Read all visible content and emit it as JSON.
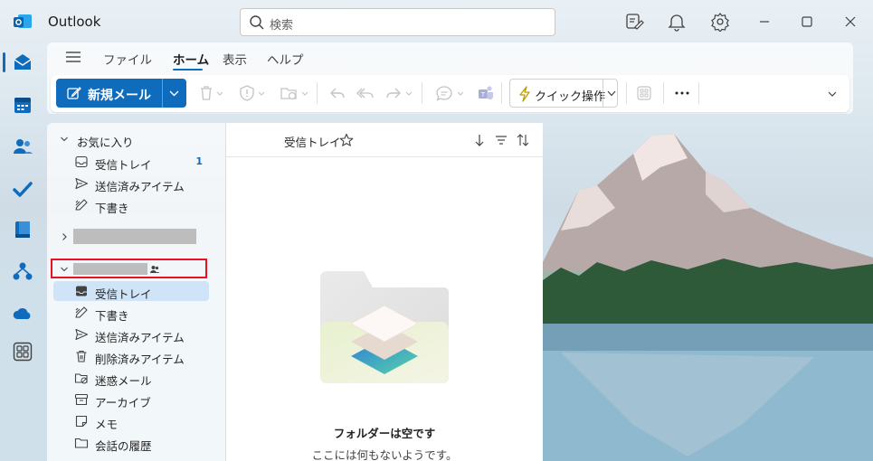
{
  "app": {
    "title": "Outlook",
    "accent_color": "#0f6cbd"
  },
  "search": {
    "placeholder": "検索",
    "icon": "search-icon"
  },
  "titlebar_icons": [
    "whats-new-icon",
    "bell-icon",
    "gear-icon",
    "minimize-icon",
    "maximize-icon",
    "close-icon"
  ],
  "rail": {
    "items": [
      "mail-icon",
      "calendar-icon",
      "people-icon",
      "todo-icon",
      "bookings-icon",
      "org-icon",
      "onedrive-icon",
      "apps-icon"
    ],
    "selected": "mail-icon"
  },
  "menu": {
    "tabs": [
      {
        "label": "ファイル"
      },
      {
        "label": "ホーム",
        "active": true
      },
      {
        "label": "表示"
      },
      {
        "label": "ヘルプ"
      }
    ]
  },
  "toolbar": {
    "new_mail_label": "新規メール",
    "quick_steps_label": "クイック操作",
    "icons": [
      "delete-icon",
      "report-icon",
      "move-icon",
      "reply-icon",
      "reply-all-icon",
      "forward-icon",
      "chat-icon",
      "teams-icon",
      "addins-icon",
      "more-icon",
      "expand-icon"
    ]
  },
  "folders": {
    "favorites_label": "お気に入り",
    "favorites": [
      {
        "label": "受信トレイ",
        "count": "1",
        "icon": "inbox-icon"
      },
      {
        "label": "送信済みアイテム",
        "icon": "send-icon"
      },
      {
        "label": "下書き",
        "icon": "draft-icon"
      }
    ],
    "account_folders": [
      {
        "label": "受信トレイ",
        "icon": "inbox-icon",
        "selected": true
      },
      {
        "label": "下書き",
        "icon": "draft-icon"
      },
      {
        "label": "送信済みアイテム",
        "icon": "send-icon"
      },
      {
        "label": "削除済みアイテム",
        "icon": "delete-icon"
      },
      {
        "label": "迷惑メール",
        "icon": "junk-icon"
      },
      {
        "label": "アーカイブ",
        "icon": "archive-icon"
      },
      {
        "label": "メモ",
        "icon": "note-icon"
      },
      {
        "label": "会話の履歴",
        "icon": "folder-icon"
      }
    ]
  },
  "message_list": {
    "title": "受信トレイ",
    "empty_title": "フォルダーは空です",
    "empty_subtitle": "ここには何もないようです。"
  }
}
